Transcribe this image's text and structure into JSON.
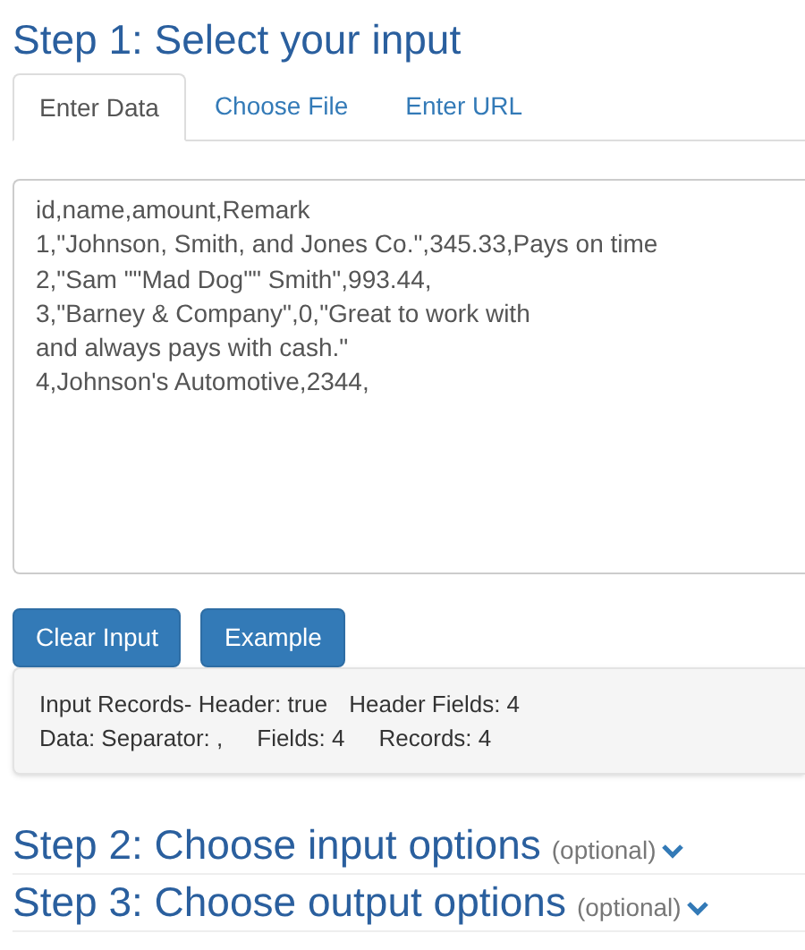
{
  "step1": {
    "title": "Step 1: Select your input",
    "tabs": [
      {
        "label": "Enter Data",
        "selected": true
      },
      {
        "label": "Choose File",
        "selected": false
      },
      {
        "label": "Enter URL",
        "selected": false
      }
    ],
    "input": {
      "value": "id,name,amount,Remark\n1,\"Johnson, Smith, and Jones Co.\",345.33,Pays on time\n2,\"Sam \"\"Mad Dog\"\" Smith\",993.44,\n3,\"Barney & Company\",0,\"Great to work with\nand always pays with cash.\"\n4,Johnson's Automotive,2344,"
    },
    "buttons": [
      "Clear Input",
      "Example"
    ],
    "stats": [
      [
        "Input Records- Header: true",
        "Header Fields: 4"
      ],
      [
        "Data: Separator: ,",
        "Fields: 4",
        "Records: 4"
      ]
    ]
  },
  "sections": [
    {
      "title": "Step 2: Choose input options",
      "note": "(optional)",
      "expanded": false
    },
    {
      "title": "Step 3: Choose output options",
      "note": "(optional)",
      "expanded": false
    }
  ]
}
